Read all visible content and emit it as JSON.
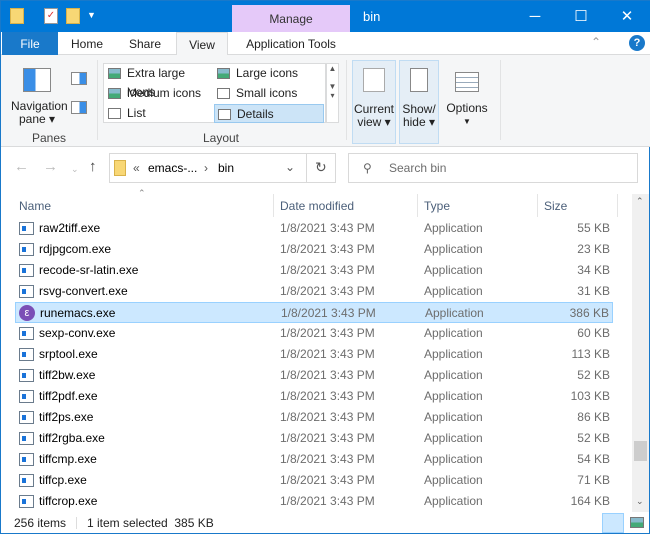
{
  "title": {
    "manage": "Manage",
    "window": "bin",
    "minimize": "─",
    "maximize": "☐",
    "close": "✕"
  },
  "tabs": {
    "file": "File",
    "home": "Home",
    "share": "Share",
    "view": "View",
    "app_tools": "Application Tools"
  },
  "ribbon": {
    "nav_pane": "Navigation pane ▾",
    "panes": "Panes",
    "layout": "Layout",
    "layouts": [
      "Extra large icons",
      "Large icons",
      "Medium icons",
      "Small icons",
      "List",
      "Details"
    ],
    "current_view": "Current view ▾",
    "show_hide": "Show/ hide ▾",
    "options": "Options"
  },
  "address": {
    "prefix": "«",
    "crumb1": "emacs-...",
    "sep": "›",
    "crumb2": "bin"
  },
  "search": {
    "placeholder": "Search bin"
  },
  "columns": {
    "name": "Name",
    "date": "Date modified",
    "type": "Type",
    "size": "Size"
  },
  "files": [
    {
      "name": "raw2tiff.exe",
      "date": "1/8/2021 3:43 PM",
      "type": "Application",
      "size": "55 KB"
    },
    {
      "name": "rdjpgcom.exe",
      "date": "1/8/2021 3:43 PM",
      "type": "Application",
      "size": "23 KB"
    },
    {
      "name": "recode-sr-latin.exe",
      "date": "1/8/2021 3:43 PM",
      "type": "Application",
      "size": "34 KB"
    },
    {
      "name": "rsvg-convert.exe",
      "date": "1/8/2021 3:43 PM",
      "type": "Application",
      "size": "31 KB"
    },
    {
      "name": "runemacs.exe",
      "date": "1/8/2021 3:43 PM",
      "type": "Application",
      "size": "386 KB",
      "selected": true
    },
    {
      "name": "sexp-conv.exe",
      "date": "1/8/2021 3:43 PM",
      "type": "Application",
      "size": "60 KB"
    },
    {
      "name": "srptool.exe",
      "date": "1/8/2021 3:43 PM",
      "type": "Application",
      "size": "113 KB"
    },
    {
      "name": "tiff2bw.exe",
      "date": "1/8/2021 3:43 PM",
      "type": "Application",
      "size": "52 KB"
    },
    {
      "name": "tiff2pdf.exe",
      "date": "1/8/2021 3:43 PM",
      "type": "Application",
      "size": "103 KB"
    },
    {
      "name": "tiff2ps.exe",
      "date": "1/8/2021 3:43 PM",
      "type": "Application",
      "size": "86 KB"
    },
    {
      "name": "tiff2rgba.exe",
      "date": "1/8/2021 3:43 PM",
      "type": "Application",
      "size": "52 KB"
    },
    {
      "name": "tiffcmp.exe",
      "date": "1/8/2021 3:43 PM",
      "type": "Application",
      "size": "54 KB"
    },
    {
      "name": "tiffcp.exe",
      "date": "1/8/2021 3:43 PM",
      "type": "Application",
      "size": "71 KB"
    },
    {
      "name": "tiffcrop.exe",
      "date": "1/8/2021 3:43 PM",
      "type": "Application",
      "size": "164 KB"
    }
  ],
  "status": {
    "count": "256 items",
    "selected": "1 item selected  385 KB"
  }
}
